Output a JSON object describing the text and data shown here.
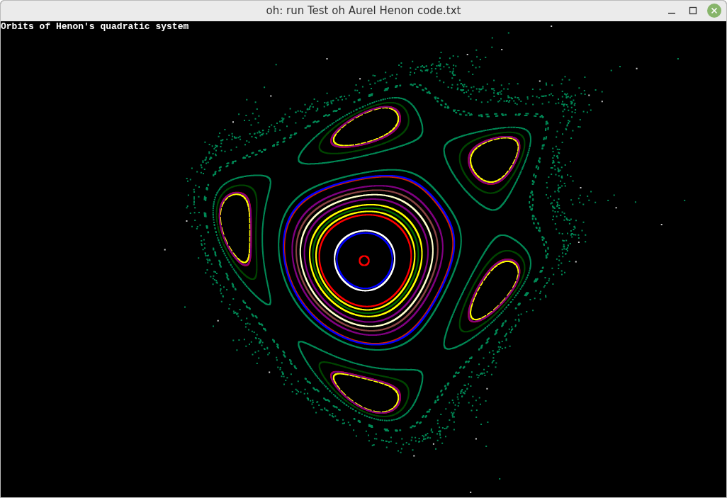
{
  "window": {
    "title": "oh: run Test oh Aurel Henon code.txt"
  },
  "plot": {
    "title": "Orbits of Henon's quadratic system"
  }
}
